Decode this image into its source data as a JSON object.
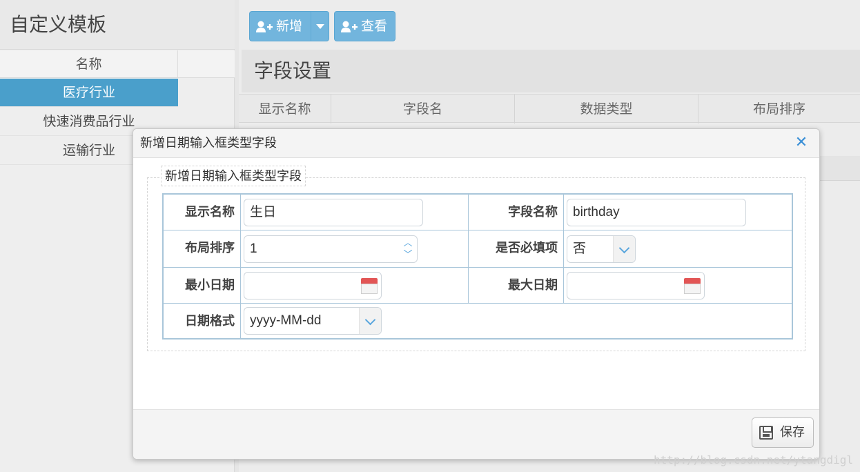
{
  "left": {
    "title": "自定义模板",
    "header": "名称",
    "items": [
      {
        "label": "医疗行业",
        "selected": true
      },
      {
        "label": "快速消费品行业",
        "selected": false
      },
      {
        "label": "运输行业",
        "selected": false
      }
    ]
  },
  "toolbar": {
    "add_label": "新增",
    "view_label": "查看",
    "accent": "#72b5dd"
  },
  "section": {
    "title": "字段设置",
    "columns": [
      "显示名称",
      "字段名",
      "数据类型",
      "布局排序"
    ]
  },
  "dialog": {
    "title": "新增日期输入框类型字段",
    "legend": "新增日期输入框类型字段",
    "fields": {
      "display_name": {
        "label": "显示名称",
        "value": "生日"
      },
      "field_name": {
        "label": "字段名称",
        "value": "birthday"
      },
      "layout_order": {
        "label": "布局排序",
        "value": "1"
      },
      "required": {
        "label": "是否必填项",
        "value": "否"
      },
      "min_date": {
        "label": "最小日期",
        "value": ""
      },
      "max_date": {
        "label": "最大日期",
        "value": ""
      },
      "date_format": {
        "label": "日期格式",
        "value": "yyyy-MM-dd"
      }
    },
    "save_label": "保存"
  },
  "watermark": "http://blog.csdn.net/ytangdigl"
}
